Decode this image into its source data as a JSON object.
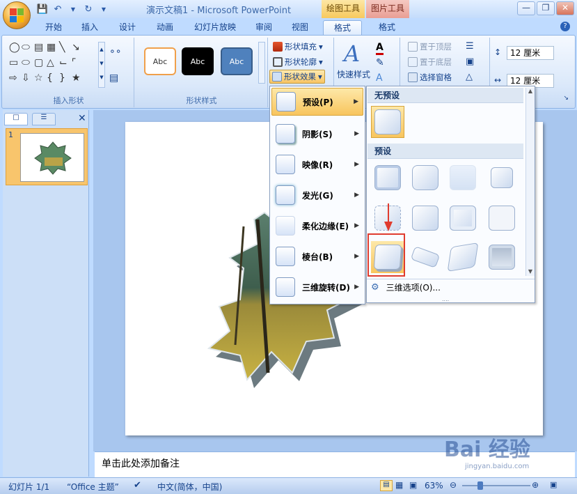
{
  "window": {
    "title": "演示文稿1 - Microsoft PowerPoint",
    "ctx_drawing": "绘图工具",
    "ctx_picture": "图片工具"
  },
  "tabs": [
    "开始",
    "插入",
    "设计",
    "动画",
    "幻灯片放映",
    "审阅",
    "视图",
    "格式",
    "格式"
  ],
  "ribbon": {
    "insert_shapes_label": "插入形状",
    "style_sample": "Abc",
    "shape_styles_label": "形状样式",
    "fill": "形状填充",
    "outline": "形状轮廓",
    "effects": "形状效果",
    "quick_styles": "快速样式",
    "bring_front": "置于顶层",
    "send_back": "置于底层",
    "selection_pane": "选择窗格",
    "height": "12 厘米",
    "width": "12 厘米"
  },
  "slides_panel": {
    "slide_number": "1"
  },
  "effects_menu": [
    {
      "label": "预设(P)"
    },
    {
      "label": "阴影(S)"
    },
    {
      "label": "映像(R)"
    },
    {
      "label": "发光(G)"
    },
    {
      "label": "柔化边缘(E)"
    },
    {
      "label": "棱台(B)"
    },
    {
      "label": "三维旋转(D)"
    }
  ],
  "preset_menu": {
    "no_preset": "无预设",
    "presets": "预设",
    "options": "三维选项(O)..."
  },
  "notes": {
    "placeholder": "单击此处添加备注"
  },
  "status": {
    "slide": "幻灯片 1/1",
    "theme": "“Office 主题”",
    "lang": "中文(简体，中国)",
    "zoom": "63%"
  },
  "watermark": {
    "text": "Bai 经验",
    "url": "jingyan.baidu.com"
  },
  "colors": {
    "accent": "#f8c55e",
    "highlight": "#e03b2e"
  }
}
